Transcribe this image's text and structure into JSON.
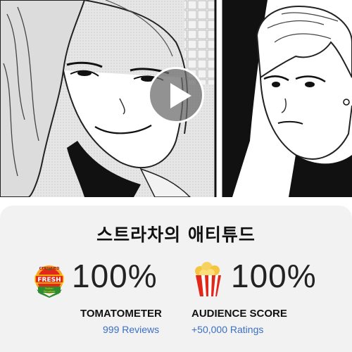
{
  "title": "스트라차의 애티튜드",
  "scores": {
    "tomatometer": {
      "value": "100%",
      "label": "TOMATOMETER",
      "reviews": "999 Reviews",
      "badge_text": [
        "CERTIFIED",
        "FRESH",
        "Rotten",
        "Tomatoes"
      ]
    },
    "audience": {
      "value": "100%",
      "label": "AUDIENCE SCORE",
      "ratings": "+50,000 Ratings"
    }
  },
  "colors": {
    "card_background": "#f2f2f2",
    "link": "#3b6fc4",
    "badge_red": "#e2281b",
    "badge_green": "#2e8b2e",
    "badge_gold": "#f5a623"
  },
  "icons": {
    "play": "play-icon",
    "fresh_badge": "certified-fresh-icon",
    "popcorn": "popcorn-icon"
  }
}
